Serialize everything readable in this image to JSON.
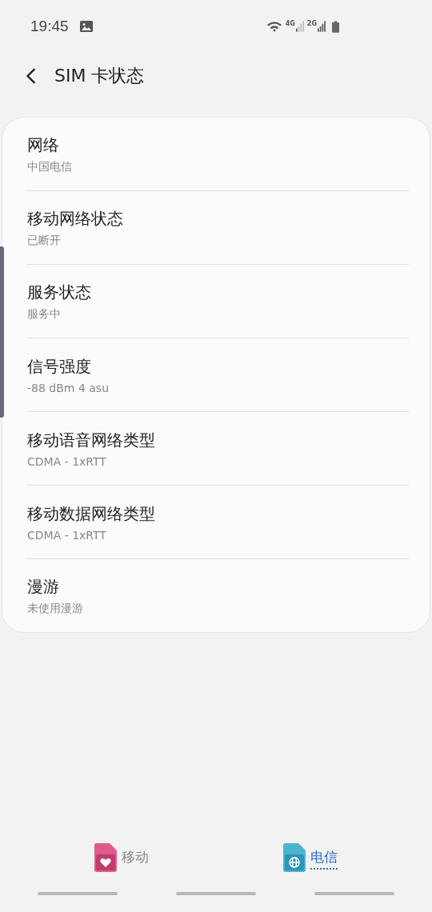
{
  "status_bar": {
    "time": "19:45",
    "network_labels": [
      "4G",
      "2G"
    ]
  },
  "header": {
    "title": "SIM 卡状态"
  },
  "items": [
    {
      "title": "网络",
      "value": "中国电信"
    },
    {
      "title": "移动网络状态",
      "value": "已断开"
    },
    {
      "title": "服务状态",
      "value": "服务中"
    },
    {
      "title": "信号强度",
      "value": "-88 dBm 4 asu"
    },
    {
      "title": "移动语音网络类型",
      "value": "CDMA - 1xRTT"
    },
    {
      "title": "移动数据网络类型",
      "value": "CDMA - 1xRTT"
    },
    {
      "title": "漫游",
      "value": "未使用漫游"
    }
  ],
  "sim_tabs": [
    {
      "label": "移动",
      "kind": "heart",
      "selected": false
    },
    {
      "label": "电信",
      "kind": "globe",
      "selected": true
    }
  ]
}
